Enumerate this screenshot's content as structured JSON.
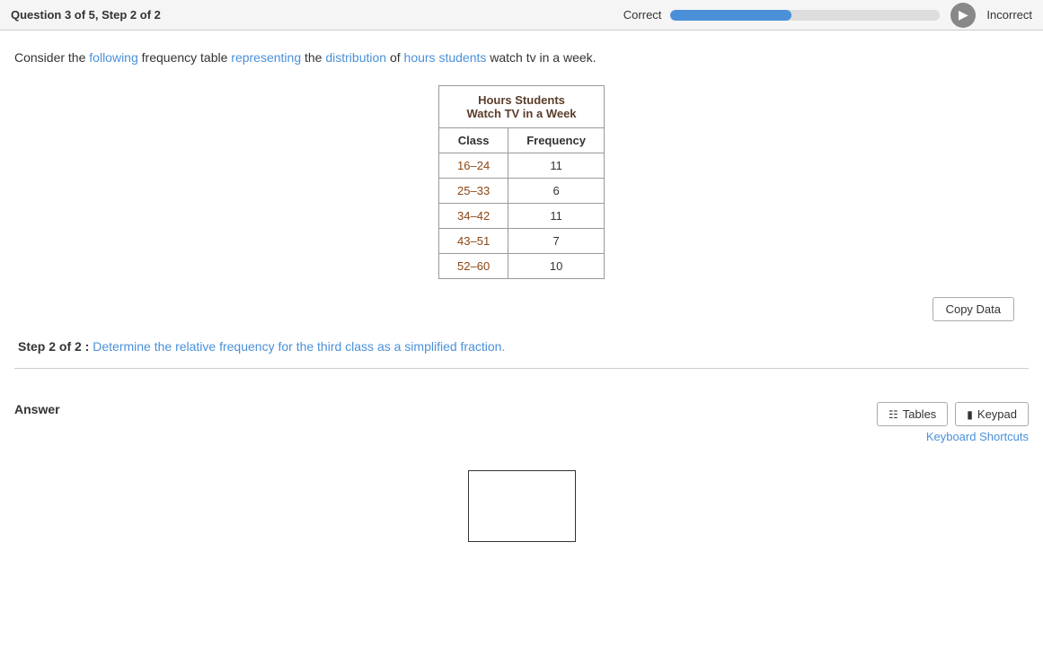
{
  "header": {
    "question_label": "Question 3 of 5,  Step 2 of 2",
    "correct_label": "Correct",
    "incorrect_label": "Incorrect",
    "progress_percent": 45
  },
  "question": {
    "text_parts": [
      {
        "text": "Consider the ",
        "highlight": false
      },
      {
        "text": "following",
        "highlight": true
      },
      {
        "text": " frequency table ",
        "highlight": false
      },
      {
        "text": "representing",
        "highlight": true
      },
      {
        "text": " the ",
        "highlight": false
      },
      {
        "text": "distribution",
        "highlight": true
      },
      {
        "text": " of ",
        "highlight": false
      },
      {
        "text": "hours students",
        "highlight": true
      },
      {
        "text": " watch tv in a week.",
        "highlight": false
      }
    ],
    "full_text": "Consider the following frequency table representing the distribution of hours students watch tv in a week."
  },
  "table": {
    "title_line1": "Hours Students",
    "title_line2": "Watch TV in a Week",
    "headers": [
      "Class",
      "Frequency"
    ],
    "rows": [
      {
        "class": "16–24",
        "frequency": "11"
      },
      {
        "class": "25–33",
        "frequency": "6"
      },
      {
        "class": "34–42",
        "frequency": "11"
      },
      {
        "class": "43–51",
        "frequency": "7"
      },
      {
        "class": "52–60",
        "frequency": "10"
      }
    ]
  },
  "copy_data_button": "Copy Data",
  "step": {
    "label": "Step 2 of 2 :",
    "body": " Determine the relative frequency for the third class as a simplified fraction."
  },
  "answer_section": {
    "label": "Answer",
    "tables_button": "Tables",
    "keypad_button": "Keypad",
    "keyboard_shortcuts": "Keyboard Shortcuts"
  }
}
